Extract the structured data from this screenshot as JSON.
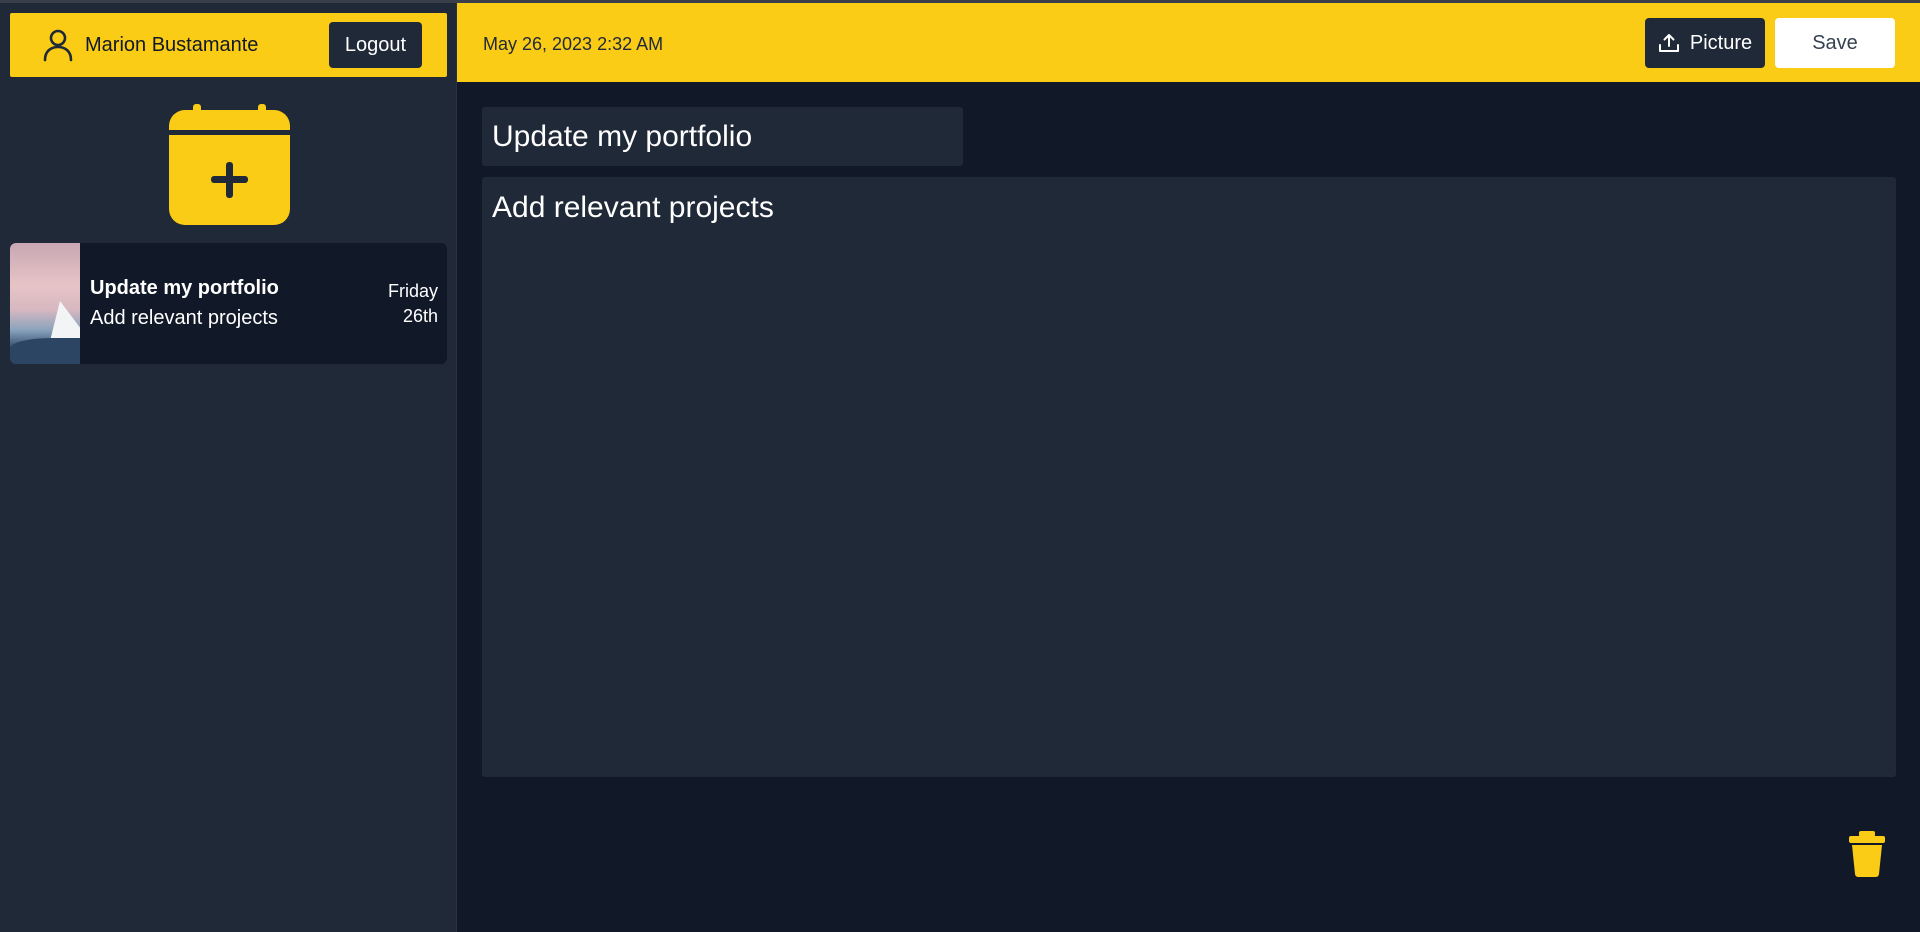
{
  "user": {
    "name": "Marion Bustamante",
    "logout_label": "Logout",
    "icon": "user-icon"
  },
  "sidebar": {
    "add_note_icon": "calendar-plus-icon",
    "notes": [
      {
        "title": "Update my portfolio",
        "body": "Add relevant projects",
        "day": "Friday",
        "date": "26th",
        "thumbnail": "mountain-sunset-image"
      }
    ]
  },
  "header": {
    "datetime": "May 26, 2023 2:32 AM",
    "picture_label": "Picture",
    "picture_icon": "upload-icon",
    "save_label": "Save"
  },
  "editor": {
    "title_value": "Update my portfolio",
    "body_value": "Add relevant projects",
    "delete_icon": "trash-icon"
  },
  "colors": {
    "accent": "#facc15",
    "sidebar_bg": "#1f2937",
    "main_bg": "#111827",
    "text": "#ffffff"
  }
}
